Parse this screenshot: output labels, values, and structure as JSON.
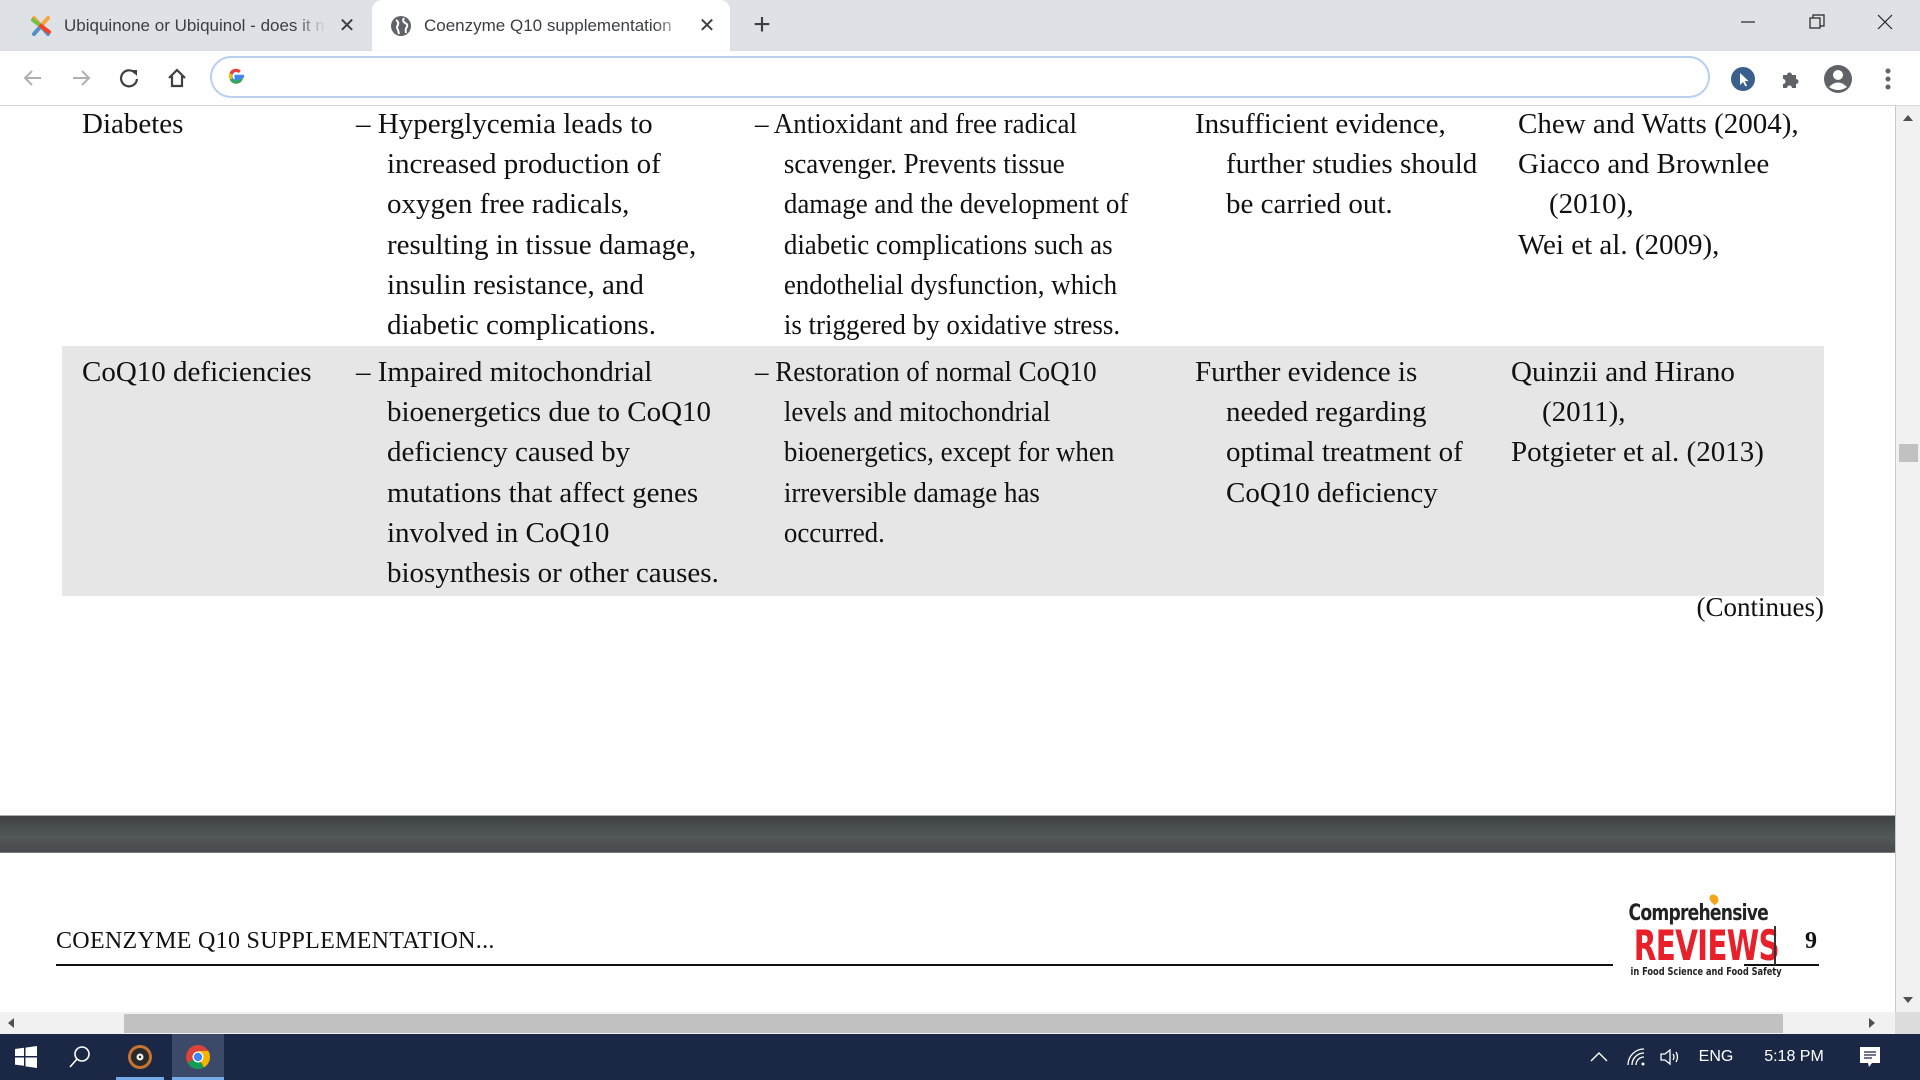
{
  "browser": {
    "tabs": [
      {
        "title": "Ubiquinone or Ubiquinol - does it matter",
        "icon": "joomla-favicon",
        "active": false
      },
      {
        "title": "Coenzyme Q10 supplementation",
        "icon": "globe-icon",
        "active": true
      }
    ],
    "new_tab_label": "+",
    "address_bar": {
      "value": "",
      "placeholder": ""
    },
    "window_controls": {
      "minimize": "—",
      "restore": "❐",
      "close": "✕"
    }
  },
  "document": {
    "table_rows": [
      {
        "condition": "Diabetes",
        "mechanism": [
          "– Hyperglycemia leads to",
          "increased production of",
          "oxygen free radicals,",
          "resulting in tissue damage,",
          "insulin resistance, and",
          "diabetic complications."
        ],
        "effect": [
          "– Antioxidant and free radical",
          "scavenger. Prevents tissue",
          "damage and the development of",
          "diabetic complications such as",
          "endothelial dysfunction, which",
          "is triggered by oxidative stress."
        ],
        "evidence": [
          "Insufficient evidence,",
          "further studies should",
          "be carried out."
        ],
        "references": [
          "Chew and Watts (2004),",
          "Giacco and Brownlee",
          "(2010),",
          "Wei et al. (2009),"
        ]
      },
      {
        "condition": "CoQ10 deficiencies",
        "mechanism": [
          "– Impaired mitochondrial",
          "bioenergetics due to CoQ10",
          "deficiency caused by",
          "mutations that affect genes",
          "involved in CoQ10",
          "biosynthesis or other causes."
        ],
        "effect": [
          "– Restoration of normal CoQ10",
          "levels and mitochondrial",
          "bioenergetics, except for when",
          "irreversible damage has",
          "occurred."
        ],
        "evidence": [
          "Further evidence is",
          "needed regarding",
          "optimal treatment of",
          "CoQ10 deficiency"
        ],
        "references": [
          "Quinzii and Hirano",
          "(2011),",
          "Potgieter et al. (2013)"
        ]
      }
    ],
    "continues_label": "(Continues)",
    "running_title": "COENZYME Q10 SUPPLEMENTATION...",
    "journal_logo": {
      "line1": "Comprehensive",
      "line2": "REVIEWS",
      "line3": "in Food Science and Food Safety"
    },
    "page_number": "9"
  },
  "taskbar": {
    "tray": {
      "language": "ENG",
      "time": "5:18 PM"
    }
  },
  "colors": {
    "tabstrip_bg": "#dee1e6",
    "row_shade": "#e6e6e6",
    "logo_red": "#e8202a",
    "taskbar_bg": "#1b2845"
  }
}
